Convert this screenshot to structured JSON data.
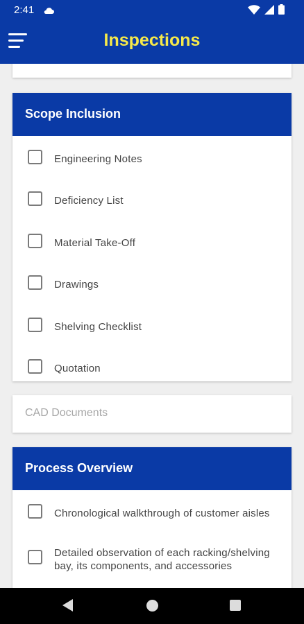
{
  "status_bar": {
    "time": "2:41"
  },
  "app_bar": {
    "title": "Inspections"
  },
  "scope_inclusion": {
    "header": "Scope Inclusion",
    "items": [
      {
        "label": "Engineering Notes",
        "checked": false
      },
      {
        "label": "Deficiency List",
        "checked": false
      },
      {
        "label": "Material Take-Off",
        "checked": false
      },
      {
        "label": "Drawings",
        "checked": false
      },
      {
        "label": "Shelving Checklist",
        "checked": false
      },
      {
        "label": "Quotation",
        "checked": false
      }
    ]
  },
  "cad_documents": {
    "placeholder": "CAD Documents"
  },
  "process_overview": {
    "header": "Process Overview",
    "items": [
      {
        "label": "Chronological walkthrough of customer aisles",
        "checked": false
      },
      {
        "label": "Detailed observation of each racking/shelving bay, its components, and accessories",
        "checked": false
      }
    ]
  },
  "colors": {
    "primary": "#0a3aa6",
    "title_yellow": "#f6e94a"
  },
  "icons": [
    "cloud-icon",
    "wifi-icon",
    "signal-icon",
    "battery-icon",
    "menu-icon",
    "back-icon",
    "home-icon",
    "recents-icon"
  ]
}
